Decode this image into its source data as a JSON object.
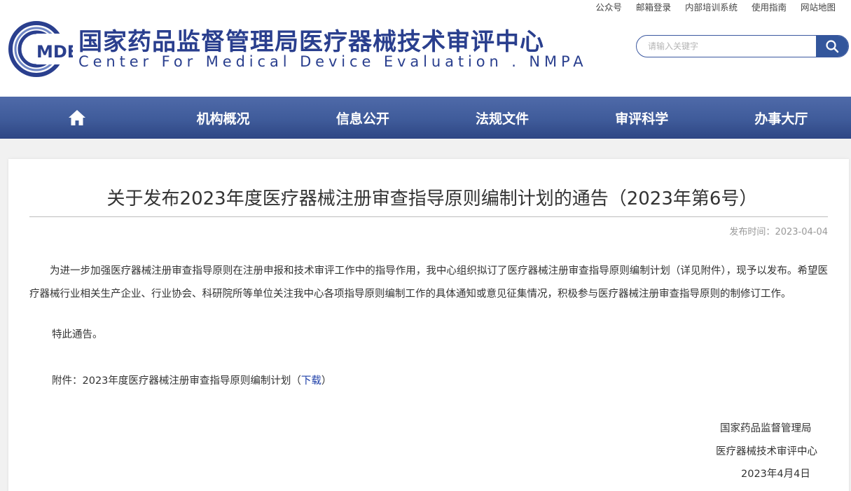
{
  "top_links": [
    "公众号",
    "邮箱登录",
    "内部培训系统",
    "使用指南",
    "网站地图"
  ],
  "logo": {
    "mark_text": "MDE",
    "name_cn": "国家药品监督管理局医疗器械技术审评中心",
    "name_en": "Center For Medical Device Evaluation . NMPA"
  },
  "search": {
    "placeholder": "请输入关键字",
    "icon": "search-icon"
  },
  "nav": {
    "home_icon": "home-icon",
    "items": [
      "机构概况",
      "信息公开",
      "法规文件",
      "审评科学",
      "办事大厅"
    ]
  },
  "article": {
    "title": "关于发布2023年度医疗器械注册审查指导原则编制计划的通告（2023年第6号）",
    "publish_label": "发布时间：",
    "publish_date": "2023-04-04",
    "paragraph": "为进一步加强医疗器械注册审查指导原则在注册申报和技术审评工作中的指导作用，我中心组织拟订了医疗器械注册审查指导原则编制计划（详见附件），现予以发布。希望医疗器械行业相关生产企业、行业协会、科研院所等单位关注我中心各项指导原则编制工作的具体通知或意见征集情况，积极参与医疗器械注册审查指导原则的制修订工作。",
    "closing": "特此通告。",
    "attachment_label": "附件：2023年度医疗器械注册审查指导原则编制计划（",
    "attachment_link": "下载",
    "attachment_suffix": "）",
    "signature": [
      "国家药品监督管理局",
      "医疗器械技术审评中心",
      "2023年4月4日"
    ]
  },
  "colors": {
    "brand": "#2a3f8e",
    "nav": "#3f5b9a",
    "link": "#1e3fa8"
  }
}
